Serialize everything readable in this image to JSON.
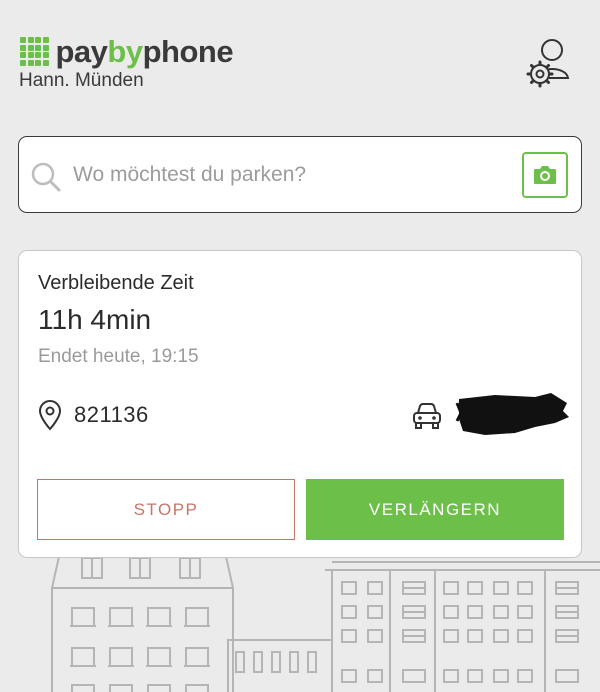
{
  "header": {
    "brand": {
      "part1": "pay",
      "part2": "by",
      "part3": "phone"
    },
    "city": "Hann. Münden",
    "account_icon": "user-settings-icon"
  },
  "search": {
    "placeholder": "Wo möchtest du parken?",
    "search_icon": "search-icon",
    "camera_icon": "camera-icon"
  },
  "session": {
    "remaining_label": "Verbleibende Zeit",
    "remaining_time": "11h 4min",
    "end_time": "Endet heute, 19:15",
    "zone": "821136",
    "location_icon": "map-pin-icon",
    "vehicle_icon": "car-icon",
    "stop_label": "STOPP",
    "extend_label": "VERLÄNGERN"
  },
  "colors": {
    "brand_green": "#6cc04a",
    "stop_red": "#c9746a",
    "background": "#ebebeb"
  }
}
